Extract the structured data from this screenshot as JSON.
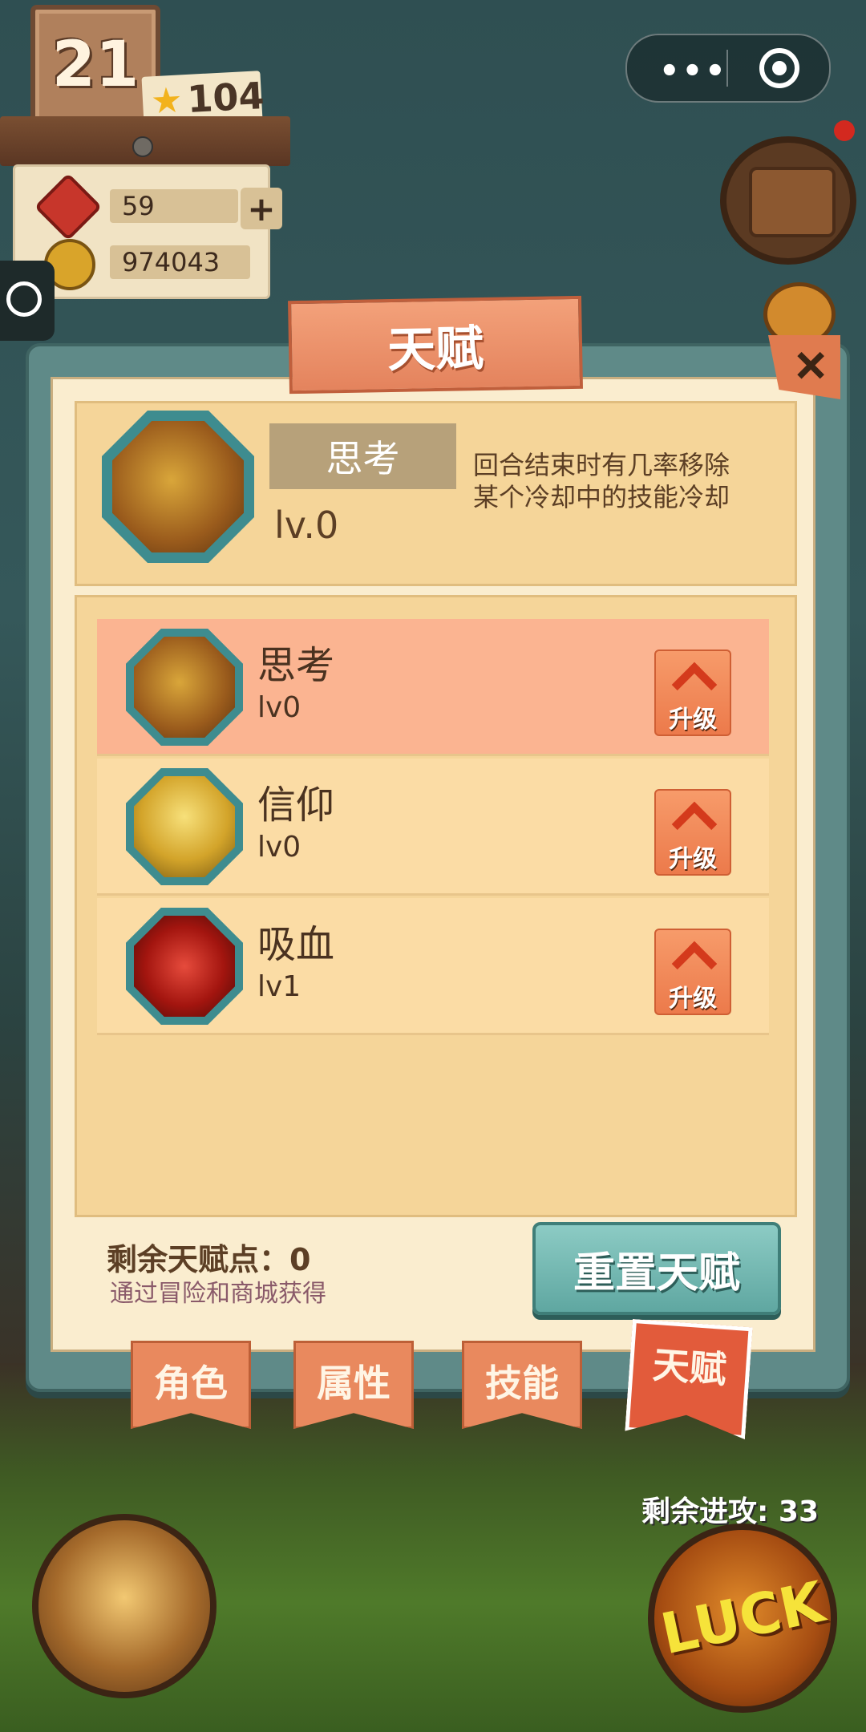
{
  "hud": {
    "level": "21",
    "stars": "104",
    "gems": "59",
    "coins": "974043",
    "plus_symbol": "+"
  },
  "capsule": {
    "menu_dots": "•••"
  },
  "modal": {
    "title": "天赋",
    "close_symbol": "+"
  },
  "detail": {
    "name": "思考",
    "level": "lv.0",
    "description_line1": "回合结束时有几率移除",
    "description_line2": "某个冷却中的技能冷却"
  },
  "talents": [
    {
      "name": "思考",
      "level": "lv0",
      "upgrade_label": "升级"
    },
    {
      "name": "信仰",
      "level": "lv0",
      "upgrade_label": "升级"
    },
    {
      "name": "吸血",
      "level": "lv1",
      "upgrade_label": "升级"
    }
  ],
  "footer": {
    "points_label": "剩余天赋点：0",
    "points_hint": "通过冒险和商城获得",
    "reset_label": "重置天赋"
  },
  "tabs": [
    {
      "label": "角色"
    },
    {
      "label": "属性"
    },
    {
      "label": "技能"
    },
    {
      "label": "天赋"
    }
  ],
  "bottom": {
    "remaining_attacks": "剩余进攻: 33",
    "luck_label": "LUCK"
  }
}
